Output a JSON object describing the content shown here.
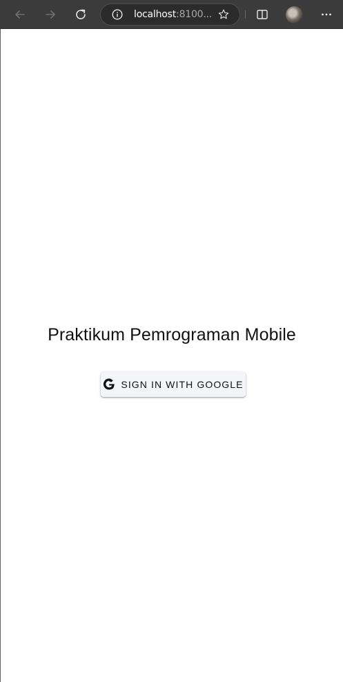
{
  "browser": {
    "url_host": "localhost",
    "url_rest": ":8100...",
    "icons": {
      "back": "back-arrow-icon",
      "forward": "forward-arrow-icon",
      "reload": "reload-icon",
      "info": "info-icon",
      "favorite": "star-icon",
      "split_screen": "split-screen-icon",
      "profile": "profile-avatar",
      "more": "more-options-icon"
    },
    "colors": {
      "toolbar_bg": "#3b3b3b",
      "address_bg": "#2b2b2b",
      "url_host": "#ffffff",
      "url_rest": "#a9a9a9"
    }
  },
  "main": {
    "title": "Praktikum Pemrograman Mobile",
    "signin_button_label": "SIGN IN WITH GOOGLE",
    "signin_button_icon": "google-icon",
    "colors": {
      "button_bg": "#f4f5f8",
      "text": "#111111"
    }
  }
}
